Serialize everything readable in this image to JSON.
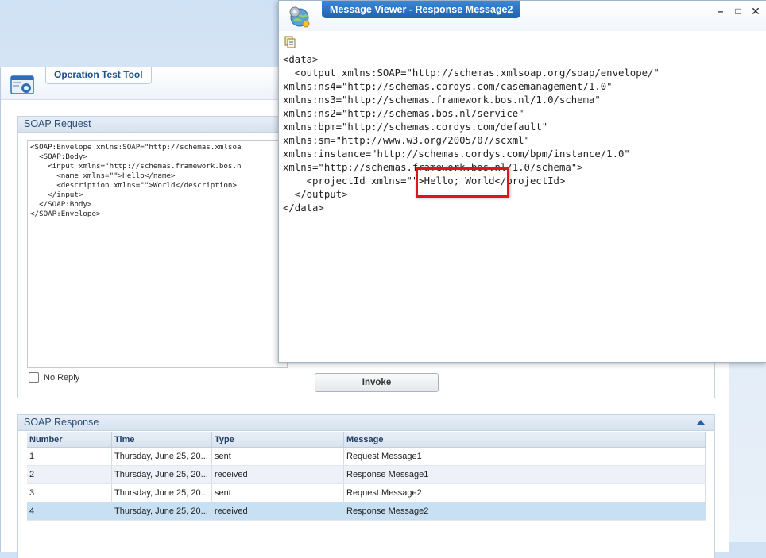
{
  "tool": {
    "title": "Operation Test Tool"
  },
  "request": {
    "title": "SOAP Request",
    "lines": [
      "<SOAP:Envelope xmlns:SOAP=\"http://schemas.xmlsoa",
      "  <SOAP:Body>",
      "    <input xmlns=\"http://schemas.framework.bos.n",
      "      <name xmlns=\"\">Hello</name>",
      "      <description xmlns=\"\">World</description>",
      "    </input>",
      "  </SOAP:Body>",
      "</SOAP:Envelope>"
    ],
    "no_reply_label": "No Reply",
    "invoke_label": "Invoke"
  },
  "response": {
    "title": "SOAP Response",
    "columns": [
      "Number",
      "Time",
      "Type",
      "Message"
    ],
    "rows": [
      {
        "number": "1",
        "time": "Thursday, June 25, 20...",
        "type": "sent",
        "message": "Request Message1"
      },
      {
        "number": "2",
        "time": "Thursday, June 25, 20...",
        "type": "received",
        "message": "Response Message1"
      },
      {
        "number": "3",
        "time": "Thursday, June 25, 20...",
        "type": "sent",
        "message": "Request Message2"
      },
      {
        "number": "4",
        "time": "Thursday, June 25, 20...",
        "type": "received",
        "message": "Response Message2"
      }
    ],
    "selected_row": "4"
  },
  "viewer": {
    "title": "Message Viewer - Response Message2",
    "window_buttons": {
      "minimize": "–",
      "maximize": "□",
      "close": "✕"
    },
    "lines": [
      "<data>",
      "  <output xmlns:SOAP=\"http://schemas.xmlsoap.org/soap/envelope/\"",
      "xmlns:ns4=\"http://schemas.cordys.com/casemanagement/1.0\"",
      "xmlns:ns3=\"http://schemas.framework.bos.nl/1.0/schema\"",
      "xmlns:ns2=\"http://schemas.bos.nl/service\"",
      "xmlns:bpm=\"http://schemas.cordys.com/default\"",
      "xmlns:sm=\"http://www.w3.org/2005/07/scxml\"",
      "xmlns:instance=\"http://schemas.cordys.com/bpm/instance/1.0\"",
      "xmlns=\"http://schemas.framework.bos.nl/1.0/schema\">",
      "    <projectId xmlns=\"\">Hello; World</projectId>",
      "  </output>",
      "</data>"
    ]
  },
  "icons": {
    "tool_logo": "operation-test-tool-logo-icon",
    "viewer_logo": "message-viewer-globe-gear-icon",
    "copy": "copy-icon",
    "collapse": "collapse-up-icon"
  },
  "colors": {
    "title_blue": "#1f62b0",
    "highlight_red": "#e0141c",
    "selected_row": "#c7e0f4"
  }
}
